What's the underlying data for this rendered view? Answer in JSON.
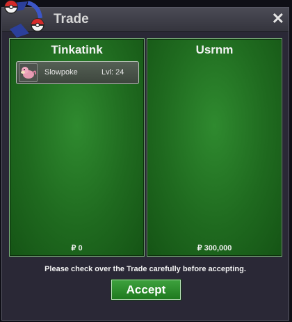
{
  "window": {
    "title": "Trade"
  },
  "left_panel": {
    "owner": "Tinkatink",
    "money": "₽ 0",
    "items": [
      {
        "name": "Slowpoke",
        "level": "Lvl: 24",
        "icon": "slowpoke-icon"
      }
    ]
  },
  "right_panel": {
    "owner": "Usrnm",
    "money": "₽ 300,000",
    "items": []
  },
  "footer": {
    "notice": "Please check over the Trade carefully before accepting.",
    "accept_label": "Accept"
  },
  "colors": {
    "panel_green": "#237023",
    "accept_green": "#2f8f2f",
    "window_bg": "#2a2836"
  }
}
